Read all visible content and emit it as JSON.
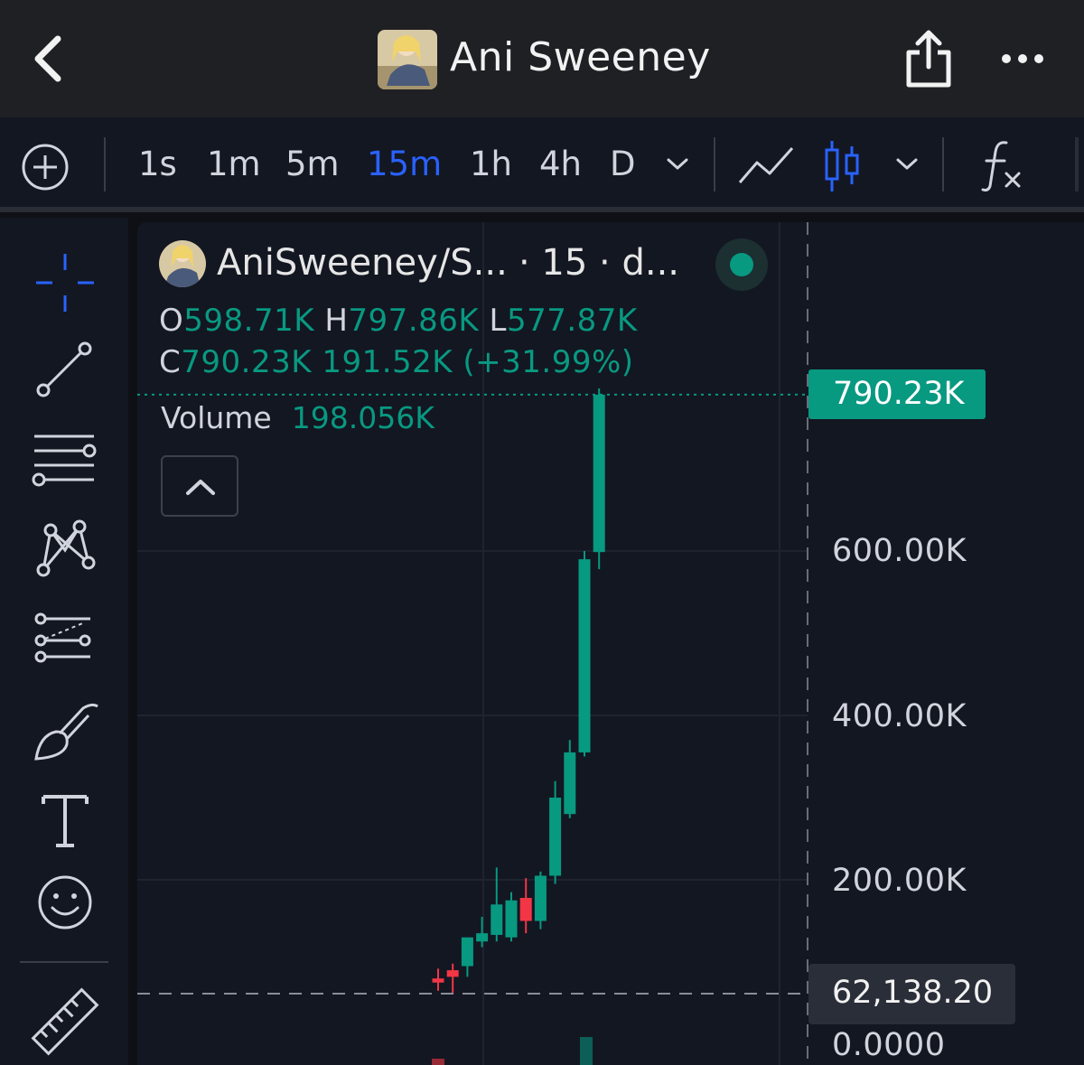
{
  "header": {
    "title": "Ani Sweeney",
    "back_icon": "chevron-left-icon",
    "share_icon": "share-icon",
    "more_icon": "more-horizontal-icon"
  },
  "toolbar": {
    "add_icon": "plus-circle-icon",
    "intervals": [
      {
        "label": "1s",
        "active": false
      },
      {
        "label": "1m",
        "active": false
      },
      {
        "label": "5m",
        "active": false
      },
      {
        "label": "15m",
        "active": true
      },
      {
        "label": "1h",
        "active": false
      },
      {
        "label": "4h",
        "active": false
      },
      {
        "label": "D",
        "active": false
      }
    ],
    "interval_dropdown_icon": "chevron-down-icon",
    "line_chart_icon": "line-chart-icon",
    "candle_chart_icon": "candlestick-icon",
    "chart_type_dropdown_icon": "chevron-down-icon",
    "indicators_icon": "function-icon"
  },
  "drawing_tools": [
    "crosshair-icon",
    "trend-line-icon",
    "horizontal-lines-icon",
    "pattern-icon",
    "fib-retracement-icon",
    "brush-icon",
    "text-icon",
    "emoji-icon",
    "ruler-icon"
  ],
  "legend": {
    "symbol": "AniSweeney/S...",
    "meta": "· 15 · d...",
    "status": "live",
    "open_label": "O",
    "open": "598.71K",
    "high_label": "H",
    "high": "797.86K",
    "low_label": "L",
    "low": "577.87K",
    "close_label": "C",
    "close": "790.23K",
    "change": "191.52K (+31.99%)",
    "volume_label": "Volume",
    "volume": "198.056K",
    "collapse_icon": "chevron-up-icon"
  },
  "price_axis": {
    "last_price": "790.23K",
    "crosshair_price": "62,138.20",
    "labels": [
      "600.00K",
      "400.00K",
      "200.00K",
      "0.0000"
    ]
  },
  "colors": {
    "up": "#089981",
    "down": "#f23645",
    "accent": "#2962ff",
    "background": "#131722"
  },
  "chart_data": {
    "type": "candlestick",
    "ylim": [
      0,
      900000
    ],
    "y_ticks": [
      200000,
      400000,
      600000
    ],
    "candles": [
      {
        "o": 75000,
        "h": 92000,
        "l": 65000,
        "c": 80000,
        "dir": "down"
      },
      {
        "o": 90000,
        "h": 98000,
        "l": 62000,
        "c": 82000,
        "dir": "down"
      },
      {
        "o": 95000,
        "h": 98000,
        "l": 82000,
        "c": 130000,
        "dir": "up"
      },
      {
        "o": 125000,
        "h": 155000,
        "l": 118000,
        "c": 135000,
        "dir": "up"
      },
      {
        "o": 133000,
        "h": 215000,
        "l": 125000,
        "c": 170000,
        "dir": "up"
      },
      {
        "o": 130000,
        "h": 185000,
        "l": 125000,
        "c": 175000,
        "dir": "up"
      },
      {
        "o": 178000,
        "h": 202000,
        "l": 135000,
        "c": 150000,
        "dir": "down"
      },
      {
        "o": 150000,
        "h": 210000,
        "l": 140000,
        "c": 205000,
        "dir": "up"
      },
      {
        "o": 205000,
        "h": 320000,
        "l": 195000,
        "c": 300000,
        "dir": "up"
      },
      {
        "o": 280000,
        "h": 370000,
        "l": 275000,
        "c": 355000,
        "dir": "up"
      },
      {
        "o": 355000,
        "h": 600000,
        "l": 350000,
        "c": 590000,
        "dir": "up"
      },
      {
        "o": 598710,
        "h": 797860,
        "l": 577870,
        "c": 790230,
        "dir": "up"
      }
    ]
  }
}
